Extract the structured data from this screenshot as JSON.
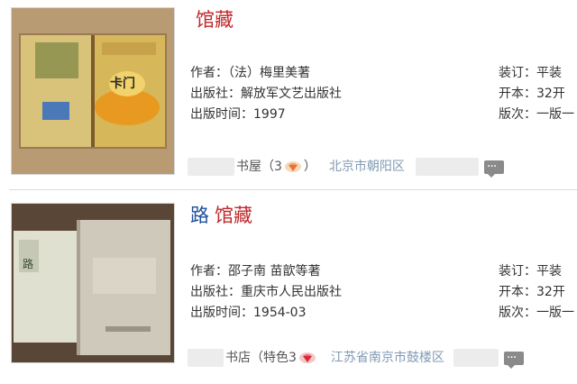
{
  "listings": [
    {
      "title": "",
      "tag": "馆藏",
      "author": "作者：（法）梅里美著",
      "publisher": "出版社：解放军文艺出版社",
      "pub_date": "出版时间：1997",
      "binding": "装订：平装",
      "format": "开本：32开",
      "edition": "版次：一版一",
      "shop_name": "书屋（3",
      "shop_suffix": "）",
      "location": "北京市朝阳区",
      "cover_text": "卡门"
    },
    {
      "title": "路",
      "tag": "馆藏",
      "author": "作者：邵子南 苗歆等著",
      "publisher": "出版社：重庆市人民出版社",
      "pub_date": "出版时间：1954-03",
      "binding": "装订：平装",
      "format": "开本：32开",
      "edition": "版次：一版一",
      "shop_name": "书店（特色3",
      "shop_suffix": "",
      "location": "江苏省南京市鼓楼区",
      "cover_text": "路"
    }
  ],
  "icons": {
    "gem": "diamond-icon",
    "chat": "chat-bubble-icon"
  },
  "colors": {
    "title_blue": "#1f4e9c",
    "tag_red": "#c0282c",
    "location_blue": "#7f9ab3"
  }
}
